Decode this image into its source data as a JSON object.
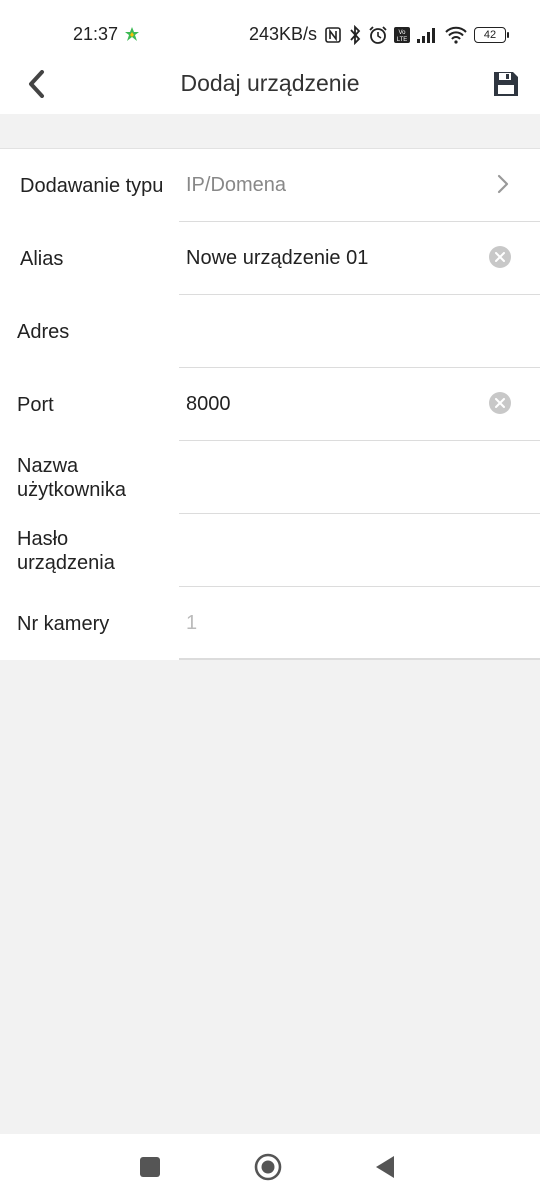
{
  "status_bar": {
    "time": "21:37",
    "network_speed": "243KB/s",
    "battery": "42",
    "icons": [
      "app-notification-icon",
      "nfc-icon",
      "bluetooth-icon",
      "alarm-icon",
      "volte-icon",
      "signal-icon",
      "wifi-icon",
      "battery-icon"
    ]
  },
  "header": {
    "title": "Dodaj urządzenie",
    "back_icon": "chevron-left-icon",
    "save_icon": "floppy-disk-icon"
  },
  "form": {
    "rows": [
      {
        "label": "Dodawanie typu",
        "value": "IP/Domena",
        "control": "chevron-right-icon"
      },
      {
        "label": "Alias",
        "value": "Nowe urządzenie 01",
        "control": "clear-icon"
      },
      {
        "label": "Adres",
        "value": ""
      },
      {
        "label": "Port",
        "value": "8000",
        "control": "clear-icon"
      },
      {
        "label": "Nazwa użytkownika",
        "value": ""
      },
      {
        "label": "Hasło urządzenia",
        "value": ""
      },
      {
        "label": "Nr kamery",
        "placeholder": "1"
      }
    ]
  },
  "nav_bar": {
    "icons": [
      "recents-square-icon",
      "home-circle-icon",
      "back-triangle-icon"
    ]
  },
  "colors": {
    "background": "#f2f2f2",
    "surface": "#ffffff",
    "text": "#222222",
    "muted": "#888888",
    "divider": "#dcdcdc"
  }
}
